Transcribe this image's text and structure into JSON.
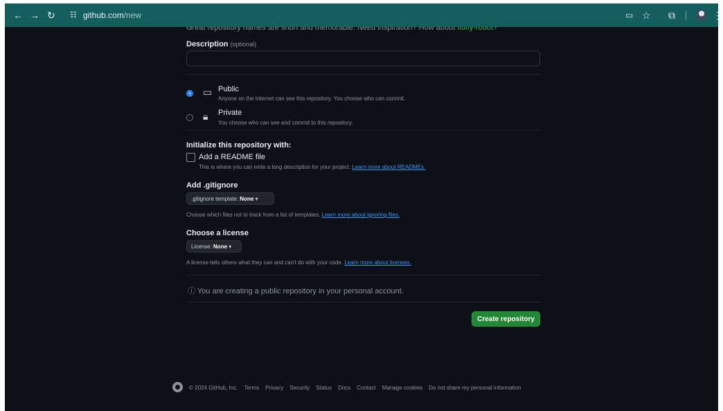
{
  "browser": {
    "url_host": "github.com",
    "url_path": "/new"
  },
  "form": {
    "name_hint_prefix": "Great repository names are short and memorable. Need inspiration? How about",
    "name_hint_suggestion": "fluffy-robot",
    "name_hint_suffix": "?",
    "description_label": "Description",
    "description_optional": "(optional)",
    "description_value": "",
    "visibility": {
      "public_title": "Public",
      "public_desc": "Anyone on the internet can see this repository. You choose who can commit.",
      "private_title": "Private",
      "private_desc": "You choose who can see and commit to this repository."
    },
    "init_heading": "Initialize this repository with:",
    "readme_label": "Add a README file",
    "readme_desc": "This is where you can write a long description for your project.",
    "readme_link": "Learn more about READMEs.",
    "gitignore_heading": "Add .gitignore",
    "gitignore_prefix": ".gitignore template:",
    "gitignore_value": "None",
    "gitignore_desc": "Choose which files not to track from a list of templates.",
    "gitignore_link": "Learn more about ignoring files.",
    "license_heading": "Choose a license",
    "license_prefix": "License:",
    "license_value": "None",
    "license_desc": "A license tells others what they can and can't do with your code.",
    "license_link": "Learn more about licenses.",
    "notice": "You are creating a public repository in your personal account.",
    "create_button": "Create repository"
  },
  "footer": {
    "copyright": "© 2024 GitHub, Inc.",
    "links": [
      "Terms",
      "Privacy",
      "Security",
      "Status",
      "Docs",
      "Contact",
      "Manage cookies",
      "Do not share my personal information"
    ]
  },
  "colors": {
    "background": "#0d1117",
    "browser_bar": "#155e5e",
    "primary_button": "#238636",
    "link": "#4493f8",
    "radio_selected": "#2f81f7"
  }
}
